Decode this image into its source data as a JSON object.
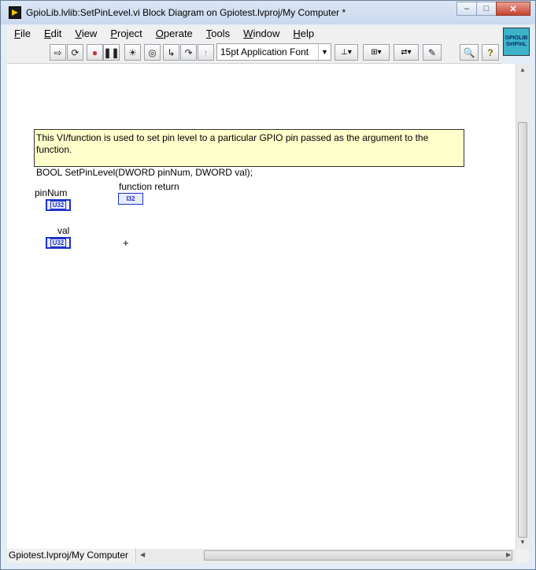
{
  "window": {
    "title": "GpioLib.lvlib:SetPinLevel.vi Block Diagram on Gpiotest.lvproj/My Computer *",
    "minimize": "–",
    "maximize": "□",
    "close": "✕"
  },
  "menu": [
    "File",
    "Edit",
    "View",
    "Project",
    "Operate",
    "Tools",
    "Window",
    "Help"
  ],
  "toolbar": {
    "font": "15pt Application Font"
  },
  "vi_icon": {
    "line1": "GPIOLIB",
    "line2": "SetPinL"
  },
  "diagram": {
    "comment_line1": "This VI/function is used to set pin level to a particular GPIO pin passed as the argument to the function.",
    "comment_line2": "BOOL SetPinLevel(DWORD pinNum, DWORD val);",
    "pinNum_label": "pinNum",
    "pinNum_type": "U32",
    "val_label": "val",
    "val_type": "U32",
    "return_label": "function return",
    "return_type": "I32"
  },
  "status": {
    "context": "Gpiotest.lvproj/My Computer"
  }
}
